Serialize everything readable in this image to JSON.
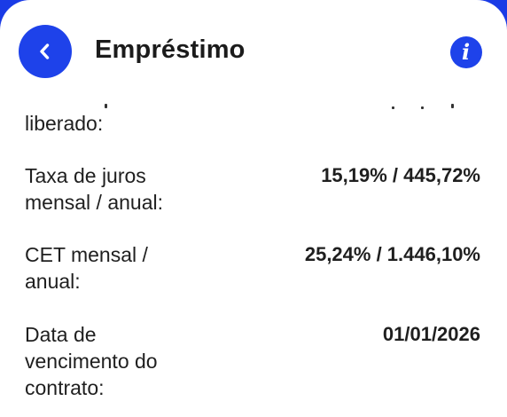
{
  "header": {
    "title": "Empréstimo",
    "back_icon": "chevron-left-icon",
    "info_icon": "info-icon",
    "accent_color": "#1e42ea"
  },
  "details": {
    "row0": {
      "label": "liberado:",
      "value": ""
    },
    "row1": {
      "label": "Taxa de juros\nmensal / anual:",
      "value": "15,19% / 445,72%"
    },
    "row2": {
      "label": "CET mensal /\nanual:",
      "value": "25,24% / 1.446,10%"
    },
    "row3": {
      "label": "Data de\nvencimento do\ncontrato:",
      "value": "01/01/2026"
    }
  }
}
